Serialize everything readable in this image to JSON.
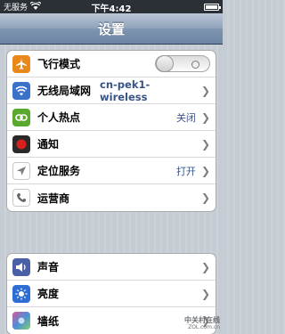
{
  "status_bar": {
    "carrier": "无服务",
    "time": "下午4:42",
    "battery_level": 0.85
  },
  "nav": {
    "title": "设置"
  },
  "groups": [
    {
      "rows": [
        {
          "label": "飞行模式",
          "icon": "airplane-icon",
          "color": "#e8871a",
          "control": "toggle",
          "toggle_on": false
        },
        {
          "label": "无线局域网",
          "value": "cn-pek1-wireless",
          "icon": "wifi-icon",
          "color": "#3a71c9"
        },
        {
          "label": "个人热点",
          "value": "关闭",
          "icon": "link-icon",
          "color": "#5aa82e"
        },
        {
          "label": "通知",
          "icon": "notification-icon",
          "color": "#d8201c"
        },
        {
          "label": "定位服务",
          "value": "打开",
          "icon": "location-arrow-icon",
          "color": "#8a8a8a"
        },
        {
          "label": "运营商",
          "icon": "phone-icon",
          "color": "#8a8a8a"
        }
      ]
    },
    {
      "rows": [
        {
          "label": "声音",
          "icon": "speaker-icon",
          "color": "#c03a2b"
        },
        {
          "label": "亮度",
          "icon": "brightness-icon",
          "color": "#2e6ed4"
        },
        {
          "label": "墙纸",
          "icon": "wallpaper-icon",
          "color": "#4c8ed8"
        }
      ]
    }
  ],
  "watermark": {
    "logo": "中关村在线",
    "sub": "ZOL.com.cn"
  }
}
